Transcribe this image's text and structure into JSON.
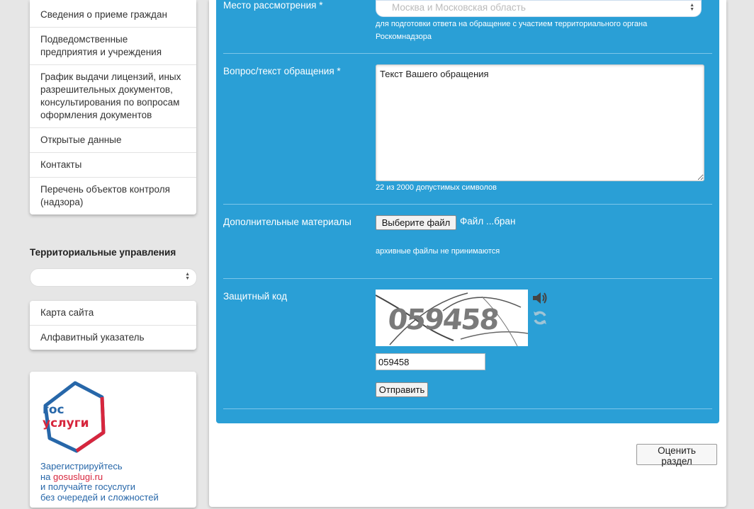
{
  "sidebar": {
    "menu": [
      {
        "label": "Сведения о приеме граждан"
      },
      {
        "label": "Подведомственные предприятия и учреждения"
      },
      {
        "label": "График выдачи лицензий, иных разрешительных документов, консультирования по вопросам оформления документов"
      },
      {
        "label": "Открытые данные"
      },
      {
        "label": "Контакты"
      },
      {
        "label": "Перечень объектов контроля (надзора)"
      }
    ],
    "territorial_heading": "Территориальные управления",
    "territorial_select_value": "",
    "links": [
      {
        "label": "Карта сайта"
      },
      {
        "label": "Алфавитный указатель"
      }
    ],
    "gosuslugi": {
      "logo_line1": "гос",
      "logo_line2": "услуги",
      "promo_line1": "Зарегистрируйтесь",
      "promo_line2_prefix": "на ",
      "promo_line2_link": "gosuslugi.ru",
      "promo_line3": "и получайте госуслуги",
      "promo_line4": "без очередей и сложностей",
      "colors": {
        "blue": "#2767a9",
        "red": "#d7263d"
      }
    }
  },
  "form": {
    "place": {
      "label": "Место рассмотрения *",
      "value": "Москва и Московская область",
      "hint": "для подготовки ответа на обращение с участием территориального органа Роскомнадзора"
    },
    "question": {
      "label": "Вопрос/текст обращения *",
      "value": "Текст Вашего обращения",
      "counter": "22 из 2000 допустимых символов"
    },
    "attachments": {
      "label": "Дополнительные материалы",
      "button": "Выберите файл",
      "status": "Файл ...бран",
      "hint": "архивные файлы не принимаются"
    },
    "captcha": {
      "label": "Защитный код",
      "image_text": "059458",
      "audio_icon": "speaker-icon",
      "refresh_icon": "refresh-icon",
      "input_value": "059458",
      "submit": "Отправить"
    },
    "colors": {
      "panel": "#2a9fd6",
      "divider": "#7cc5e9"
    }
  },
  "rate_button": "Оценить раздел"
}
